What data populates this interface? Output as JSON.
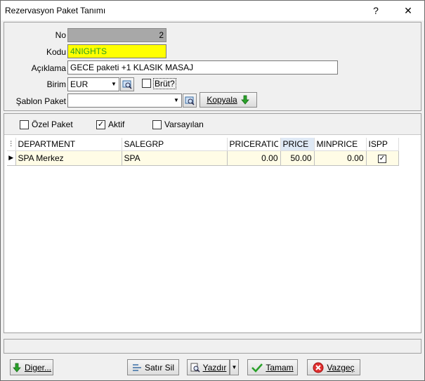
{
  "window": {
    "title": "Rezervasyon Paket Tanımı",
    "help_glyph": "?",
    "close_glyph": "✕"
  },
  "form": {
    "no_label": "No",
    "no_value": "2",
    "kodu_label": "Kodu",
    "kodu_value": "4NIGHTS",
    "aciklama_label": "Açıklama",
    "aciklama_value": "GECE paketi +1 KLASIK MASAJ",
    "birim_label": "Birim",
    "birim_value": "EUR",
    "brut_label": "Brüt?",
    "brut_checked": false,
    "sablon_label": "Şablon Paket",
    "sablon_value": "",
    "kopyala_label": "Kopyala"
  },
  "options": {
    "ozel_paket_label": "Özel Paket",
    "ozel_paket_checked": false,
    "aktif_label": "Aktif",
    "aktif_checked": true,
    "varsayilan_label": "Varsayılan",
    "varsayilan_checked": false
  },
  "grid": {
    "columns": [
      "DEPARTMENT",
      "SALEGRP",
      "PRICERATIO",
      "PRICE",
      "MINPRICE",
      "ISPP"
    ],
    "rows": [
      {
        "department": "SPA Merkez",
        "salegrp": "SPA",
        "priceratio": "0.00",
        "price": "50.00",
        "minprice": "0.00",
        "ispp": true
      }
    ]
  },
  "footer": {
    "diger_label": "Diger...",
    "satir_sil_label": "Satır Sil",
    "yazdir_label": "Yazdır",
    "tamam_label": "Tamam",
    "vazgec_label": "Vazgeç"
  },
  "colors": {
    "kodu_bg": "#ffff00",
    "kodu_text": "#2fa01e",
    "row_bg": "#fffce6"
  }
}
